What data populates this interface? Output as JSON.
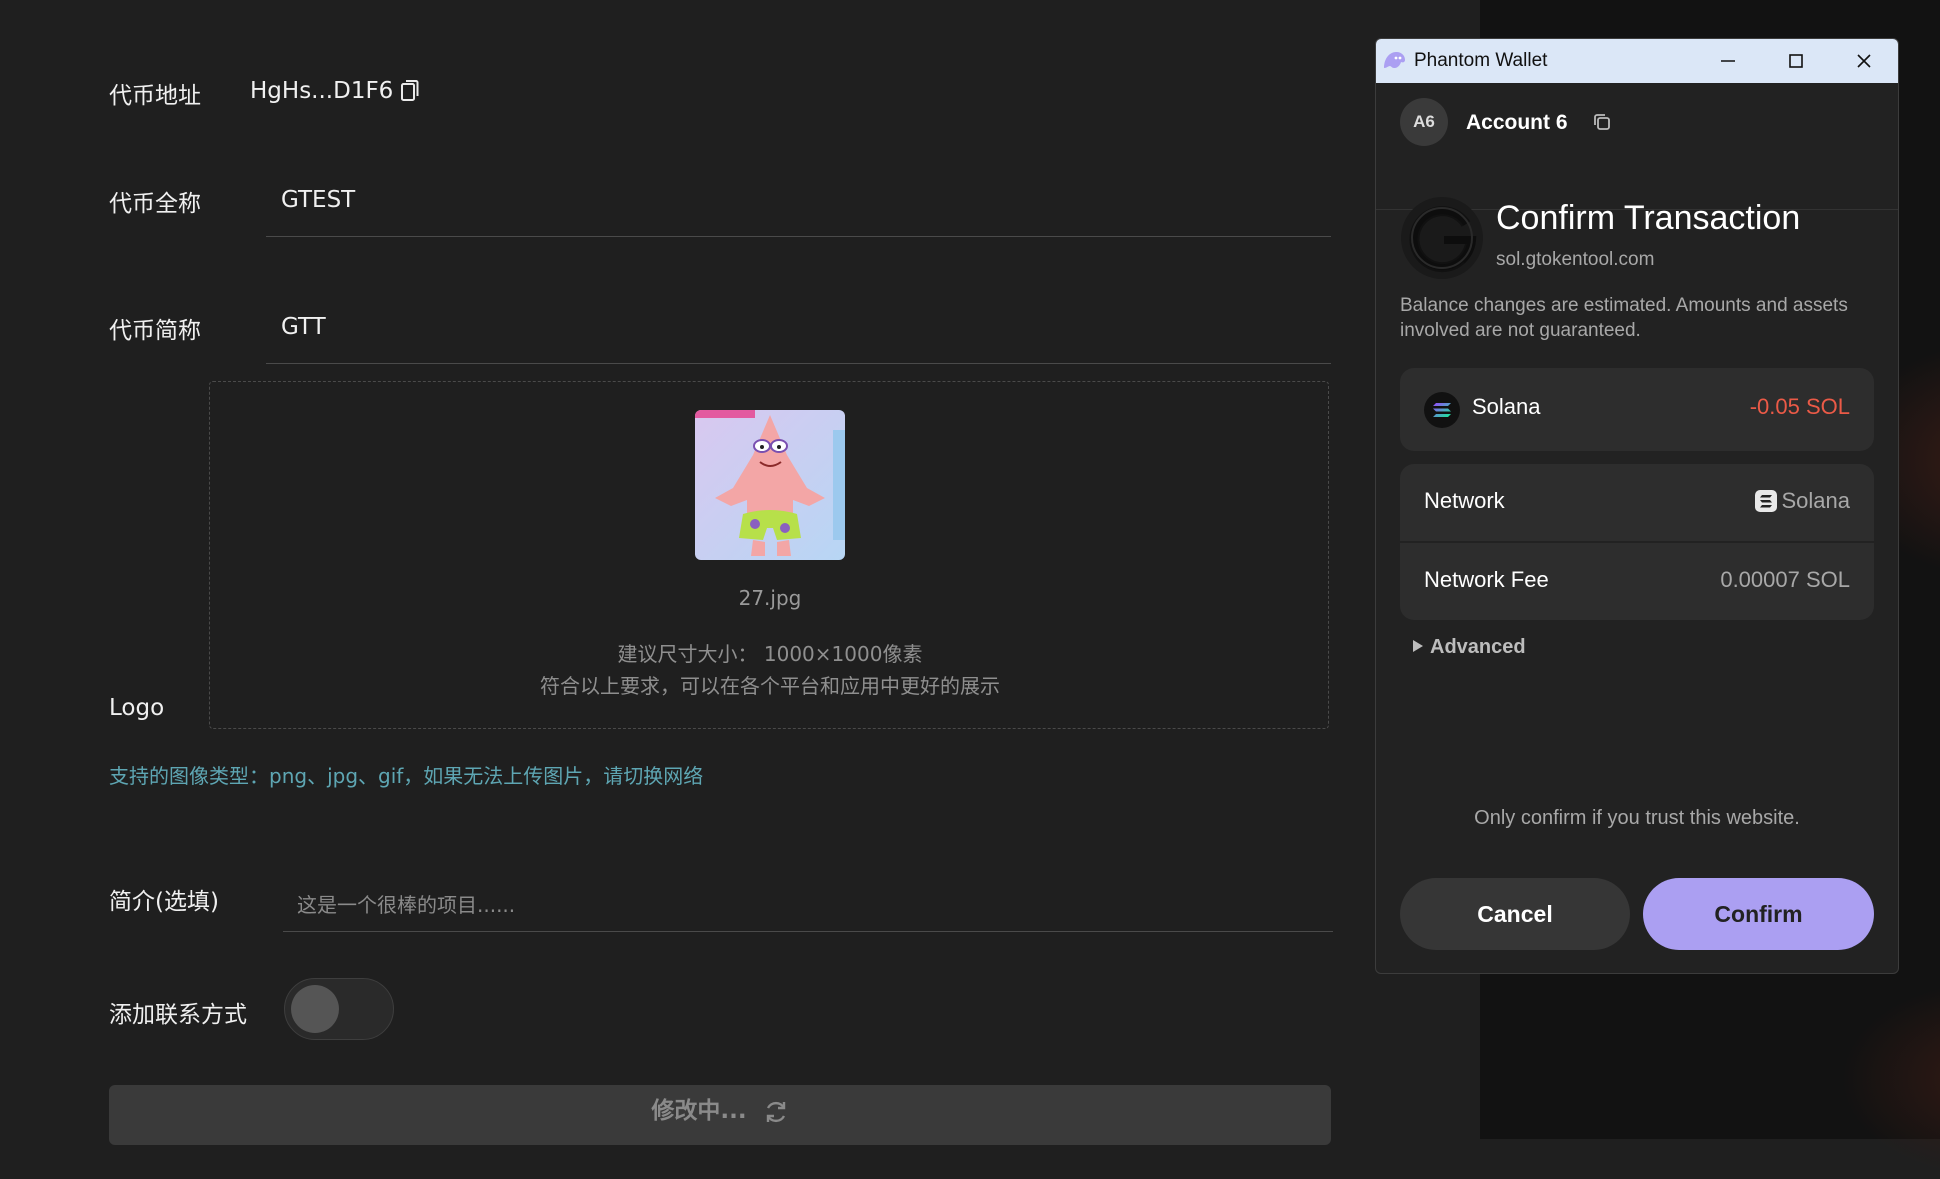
{
  "form": {
    "token_address_label": "代币地址",
    "token_address_value": "HgHs...D1F6",
    "full_name_label": "代币全称",
    "full_name_value": "GTEST",
    "symbol_label": "代币简称",
    "symbol_value": "GTT",
    "logo_label": "Logo",
    "logo_file_name": "27.jpg",
    "size_hint": "建议尺寸大小： 1000×1000像素",
    "display_hint": "符合以上要求，可以在各个平台和应用中更好的展示",
    "types_hint": "支持的图像类型：png、jpg、gif，如果无法上传图片，请切换网络",
    "intro_label": "简介(选填)",
    "intro_placeholder": "这是一个很棒的项目......",
    "contact_label": "添加联系方式",
    "contact_toggle_on": false,
    "submit_label": "修改中..."
  },
  "wallet": {
    "window_title": "Phantom Wallet",
    "account_avatar": "A6",
    "account_name": "Account 6",
    "heading": "Confirm Transaction",
    "site": "sol.gtokentool.com",
    "balance_note": "Balance changes are estimated. Amounts and assets involved are not guaranteed.",
    "asset_name": "Solana",
    "asset_change": "-0.05 SOL",
    "network_label": "Network",
    "network_value": "Solana",
    "fee_label": "Network Fee",
    "fee_value": "0.00007 SOL",
    "advanced_label": "Advanced",
    "trust_note": "Only confirm if you trust this website.",
    "cancel_label": "Cancel",
    "confirm_label": "Confirm"
  },
  "colors": {
    "accent_confirm": "#ab9ff2",
    "negative": "#eb5a47",
    "hint_teal": "#5ea6b3"
  },
  "icons": [
    "copy-icon",
    "refresh-icon",
    "phantom-ghost-icon",
    "minimize-icon",
    "maximize-icon",
    "close-icon",
    "solana-icon",
    "caret-right-icon"
  ]
}
